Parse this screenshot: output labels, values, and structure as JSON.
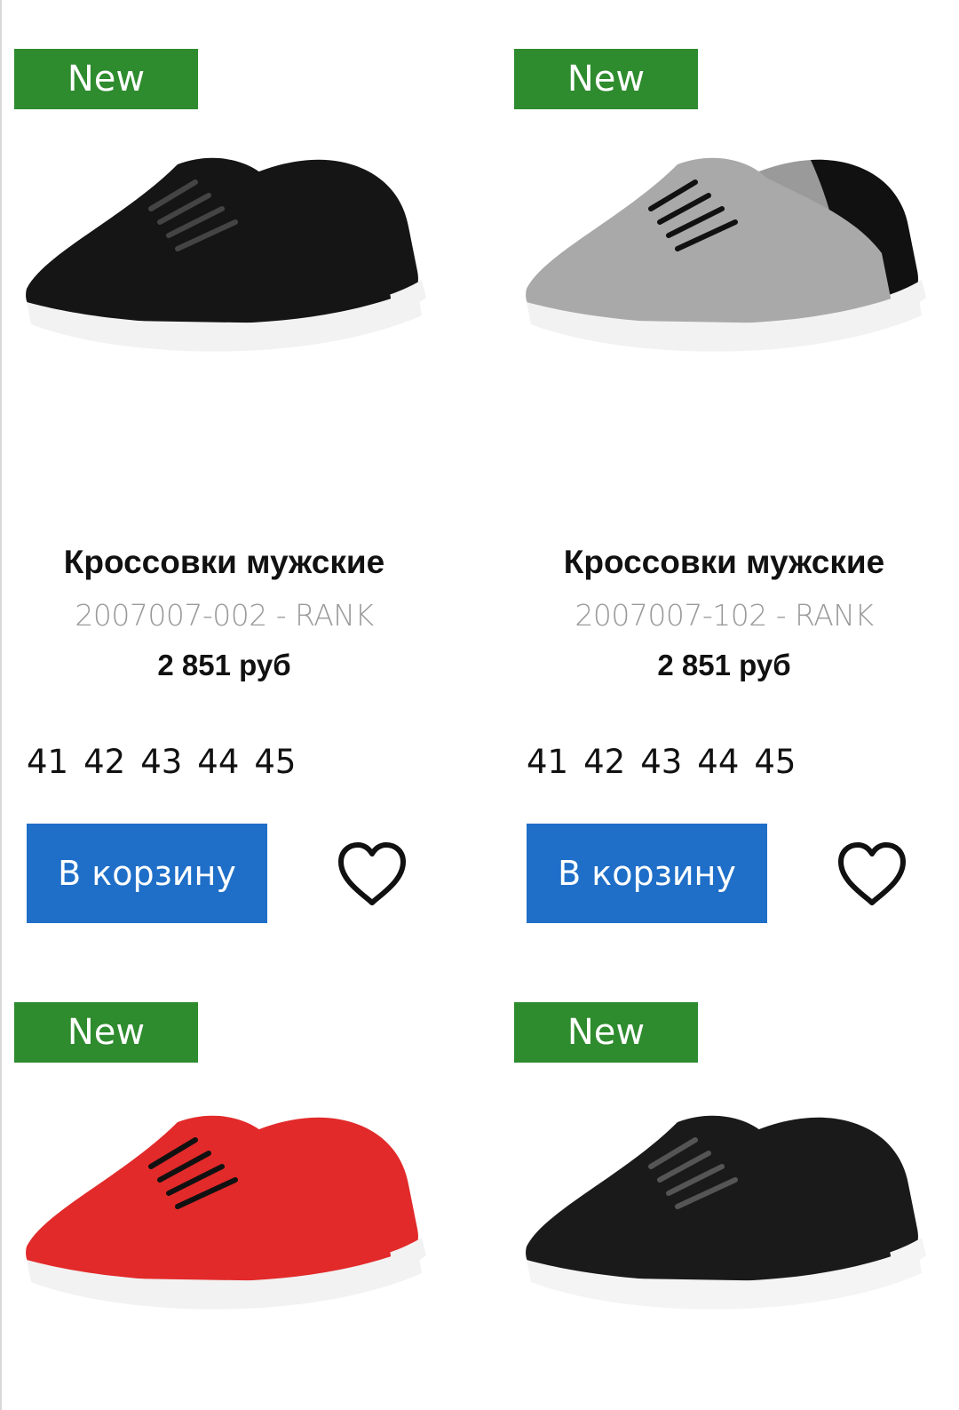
{
  "products": [
    {
      "badge": "New",
      "title": "Кроссовки мужские",
      "sku": "2007007-002 - RANK",
      "price": "2 851 руб",
      "sizes": [
        "41",
        "42",
        "43",
        "44",
        "45"
      ],
      "cart_label": "В корзину",
      "colors": {
        "upper": "#151515",
        "sole": "#f2f2f2",
        "heel": "#0d0d0d"
      }
    },
    {
      "badge": "New",
      "title": "Кроссовки мужские",
      "sku": "2007007-102 - RANK",
      "price": "2 851 руб",
      "sizes": [
        "41",
        "42",
        "43",
        "44",
        "45"
      ],
      "cart_label": "В корзину",
      "colors": {
        "upper": "#a9a9a9",
        "sole": "#f2f2f2",
        "heel": "#111111"
      }
    },
    {
      "badge": "New",
      "colors": {
        "upper": "#e22a2a",
        "sole": "#f2f2f2",
        "heel": "#111111"
      }
    },
    {
      "badge": "New",
      "colors": {
        "upper": "#1a1a1a",
        "sole": "#f4f4f4",
        "heel": "#0d0d0d"
      }
    }
  ],
  "theme": {
    "badge_bg": "#2e8b2e",
    "button_bg": "#1f6fc8"
  }
}
